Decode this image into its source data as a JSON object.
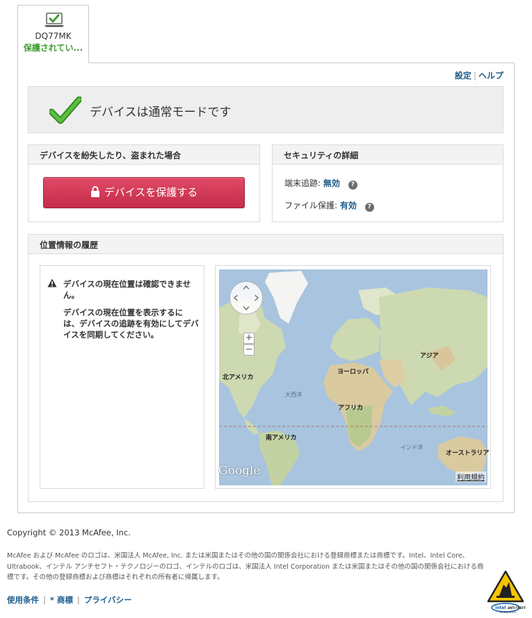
{
  "device_tab": {
    "name": "DQ77MK",
    "status": "保護されてい..."
  },
  "top_links": {
    "settings": "設定",
    "help": "ヘルプ"
  },
  "status_banner": {
    "text": "デバイスは通常モードです"
  },
  "lost_panel": {
    "heading": "デバイスを紛失したり、盗まれた場合",
    "button": "デバイスを保護する"
  },
  "security_panel": {
    "heading": "セキュリティの詳細",
    "rows": [
      {
        "label": "端末追跡:",
        "value": "無効"
      },
      {
        "label": "ファイル保護:",
        "value": "有効"
      }
    ],
    "help_glyph": "?"
  },
  "location_panel": {
    "heading": "位置情報の履歴",
    "message_1": "デバイスの現在位置は確認できません。",
    "message_2": "デバイスの現在位置を表示するには、デバイスの追跡を有効にしてデバイスを同期してください。",
    "map": {
      "labels": {
        "north_america": "北アメリカ",
        "europe": "ヨーロッパ",
        "asia": "アジア",
        "africa": "アフリカ",
        "south_america": "南アメリカ",
        "australia": "オーストラリア",
        "atlantic": "大西洋",
        "indian_ocean": "インド洋"
      },
      "google": "Google",
      "terms": "利用規約",
      "zoom_in": "+",
      "zoom_out": "−"
    }
  },
  "footer": {
    "copyright": "Copyright © 2013 McAfee, Inc.",
    "legal": "McAfee および McAfee のロゴは、米国法人 McAfee, Inc. または米国またはその他の国の関係会社における登録商標または商標です。Intel、Intel Core、Ultrabook、インテル アンチセフト・テクノロジーのロゴ、インテルのロゴは、米国法人 Intel Corporation または米国またはその他の国の関係会社における商標です。その他の登録商標および商標はそれぞれの所有者に帰属します。",
    "links": [
      "使用条件",
      "* 商標",
      "プライバシー"
    ],
    "logo_text": "intel ANTI-THEFT TECHNOLOGY"
  },
  "colors": {
    "accent_green": "#3c9d2e",
    "link_blue": "#1f5d8c",
    "button_red": "#d23a58",
    "ocean": "#a8c4df",
    "land": "#cdd9b0"
  }
}
